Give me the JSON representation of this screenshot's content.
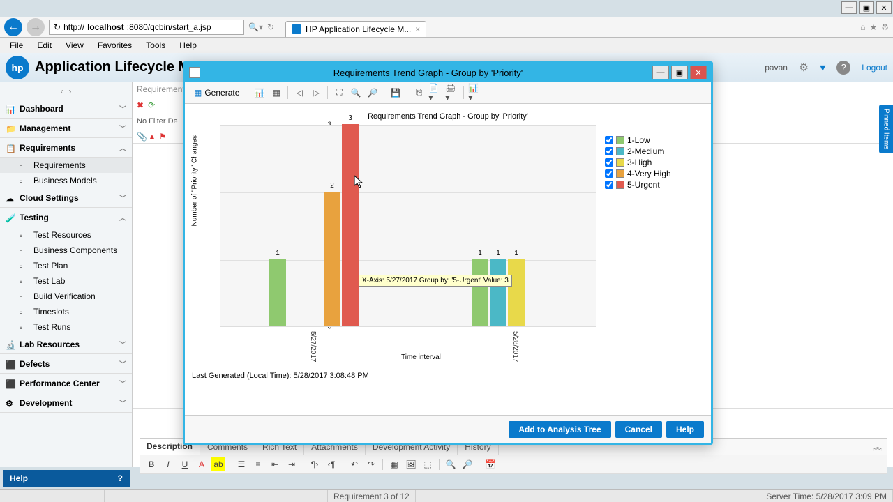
{
  "window": {
    "url_prefix": "http://",
    "url_host": "localhost",
    "url_rest": ":8080/qcbin/start_a.jsp",
    "tab": "HP Application Lifecycle M..."
  },
  "menus": [
    "File",
    "Edit",
    "View",
    "Favorites",
    "Tools",
    "Help"
  ],
  "app": {
    "title": "Application Lifecycle Management",
    "user": "pavan",
    "logout": "Logout"
  },
  "nav": {
    "groups": [
      {
        "label": "Dashboard",
        "icon": "📊"
      },
      {
        "label": "Management",
        "icon": "📁"
      },
      {
        "label": "Requirements",
        "icon": "📋",
        "expanded": true,
        "items": [
          {
            "label": "Requirements",
            "sel": true
          },
          {
            "label": "Business Models"
          }
        ]
      },
      {
        "label": "Cloud Settings",
        "icon": "☁"
      },
      {
        "label": "Testing",
        "icon": "🧪",
        "expanded": true,
        "items": [
          {
            "label": "Test Resources"
          },
          {
            "label": "Business Components"
          },
          {
            "label": "Test Plan"
          },
          {
            "label": "Test Lab"
          },
          {
            "label": "Build Verification"
          },
          {
            "label": "Timeslots"
          },
          {
            "label": "Test Runs"
          }
        ]
      },
      {
        "label": "Lab Resources",
        "icon": "🔬"
      },
      {
        "label": "Defects",
        "icon": "⬛"
      },
      {
        "label": "Performance Center",
        "icon": "⬛"
      },
      {
        "label": "Development",
        "icon": "⚙"
      }
    ]
  },
  "center": {
    "breadcrumb": "Requirements",
    "filter": "No Filter De"
  },
  "bottom_tabs": [
    "Description",
    "Comments",
    "Rich Text",
    "Attachments",
    "Development Activity",
    "History"
  ],
  "status": {
    "rec": "Requirement 3 of 12",
    "server": "Server Time: 5/28/2017 3:09 PM"
  },
  "help": "Help",
  "pinned": "Pinned Items",
  "modal": {
    "title": "Requirements Trend Graph - Group by 'Priority'",
    "generate": "Generate",
    "chart_title": "Requirements Trend Graph - Group by 'Priority'",
    "ylabel": "Number of \"Priority\" Changes",
    "xlabel": "Time interval",
    "tooltip": "X-Axis: 5/27/2017 Group by: '5-Urgent' Value: 3",
    "last_gen": "Last Generated (Local Time): 5/28/2017 3:08:48 PM",
    "legend": [
      {
        "name": "1-Low",
        "color": "#8fc96f"
      },
      {
        "name": "2-Medium",
        "color": "#4bb8c6"
      },
      {
        "name": "3-High",
        "color": "#e8d94a"
      },
      {
        "name": "4-Very High",
        "color": "#e8a23e"
      },
      {
        "name": "5-Urgent",
        "color": "#e05a4f"
      }
    ],
    "buttons": {
      "add": "Add to Analysis Tree",
      "cancel": "Cancel",
      "help": "Help"
    }
  },
  "chart_data": {
    "type": "bar",
    "title": "Requirements Trend Graph - Group by 'Priority'",
    "xlabel": "Time interval",
    "ylabel": "Number of \"Priority\" Changes",
    "ylim": [
      0,
      3
    ],
    "categories": [
      "5/27/2017",
      "5/28/2017"
    ],
    "series": [
      {
        "name": "1-Low",
        "color": "#8fc96f",
        "values": [
          1,
          1
        ]
      },
      {
        "name": "2-Medium",
        "color": "#4bb8c6",
        "values": [
          null,
          1
        ]
      },
      {
        "name": "3-High",
        "color": "#e8d94a",
        "values": [
          null,
          1
        ]
      },
      {
        "name": "4-Very High",
        "color": "#e8a23e",
        "values": [
          2,
          null
        ]
      },
      {
        "name": "5-Urgent",
        "color": "#e05a4f",
        "values": [
          3,
          null
        ]
      }
    ]
  }
}
